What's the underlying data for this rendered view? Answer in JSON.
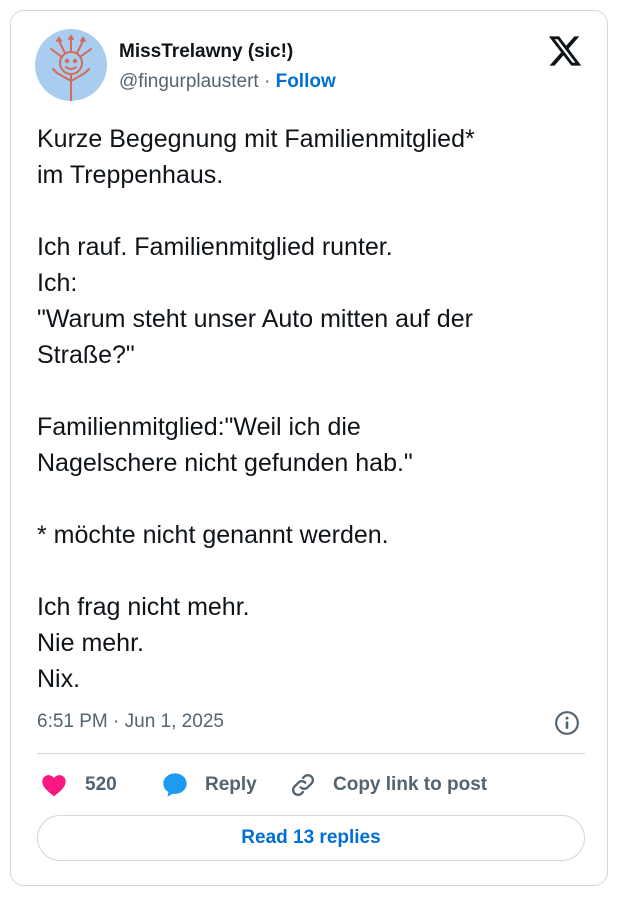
{
  "author": {
    "name": "MissTrelawny (sic!)",
    "handle": "@fingurplaustert",
    "separator": " · ",
    "follow_label": "Follow"
  },
  "post": {
    "text": "Kurze Begegnung mit Familienmitglied*\nim Treppenhaus.\n\nIch rauf. Familienmitglied runter.\nIch:\n\"Warum steht unser Auto mitten auf der\nStraße?\"\n\nFamilienmitglied:\"Weil ich die\nNagelschere nicht gefunden hab.\"\n\n* möchte nicht genannt werden.\n\nIch frag nicht mehr.\nNie mehr.\nNix.",
    "timestamp": "6:51 PM · Jun 1, 2025"
  },
  "actions": {
    "like_count": "520",
    "reply_label": "Reply",
    "copy_label": "Copy link to post"
  },
  "footer": {
    "read_replies_label": "Read 13 replies"
  },
  "icons": {
    "logo": "x-logo-icon",
    "info": "info-icon",
    "like": "heart-icon",
    "reply": "speech-bubble-icon",
    "copy": "link-icon"
  },
  "colors": {
    "heart": "#f91880",
    "reply_bubble": "#1d9bf0",
    "follow": "#006fd6",
    "secondary_text": "#536471",
    "border": "#cfd9de"
  }
}
